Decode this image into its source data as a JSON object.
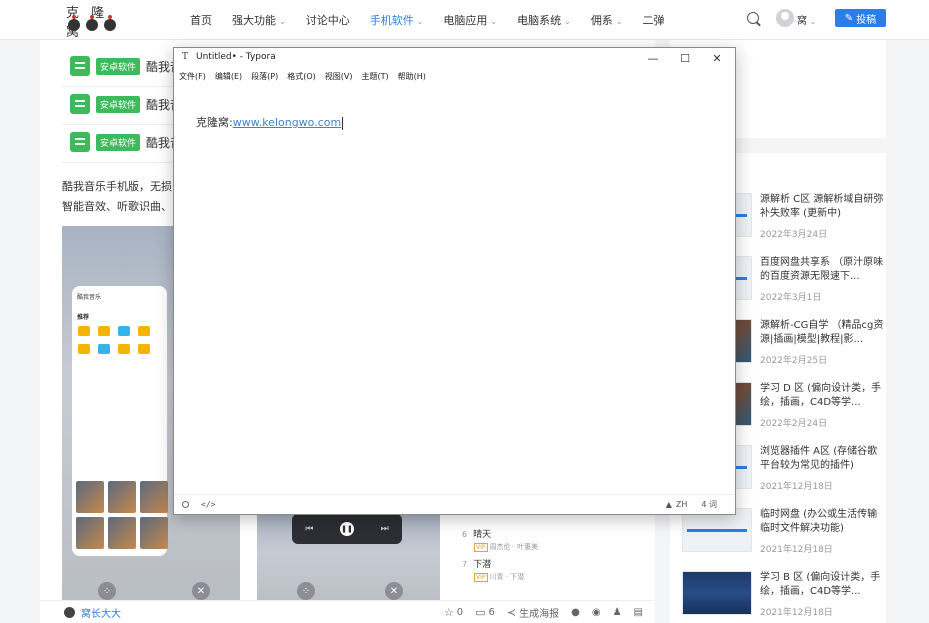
{
  "site": {
    "logo_text": "克 隆 窝",
    "nav": [
      {
        "label": "首页",
        "caret": false,
        "active": false
      },
      {
        "label": "强大功能",
        "caret": true,
        "active": false
      },
      {
        "label": "讨论中心",
        "caret": false,
        "active": false
      },
      {
        "label": "手机软件",
        "caret": true,
        "active": true
      },
      {
        "label": "电脑应用",
        "caret": true,
        "active": false
      },
      {
        "label": "电脑系统",
        "caret": true,
        "active": false
      },
      {
        "label": "佣系",
        "caret": true,
        "active": false
      },
      {
        "label": "二弹",
        "caret": false,
        "active": false
      }
    ],
    "user_name": "窝",
    "post_button": "投稿",
    "accent": "#2b7de9"
  },
  "article": {
    "app_rows": [
      {
        "tag": "安卓软件",
        "title": "酷我音"
      },
      {
        "tag": "安卓软件",
        "title": "酷我音"
      },
      {
        "tag": "安卓软件",
        "title": "酷我音"
      }
    ],
    "intro_line1": "酷我音乐手机版，无损",
    "intro_line2": "智能音效、听歌识曲、",
    "phone_app_name": "酷我音乐",
    "phone_tab": "推荐",
    "songs": [
      {
        "idx": "6",
        "name": "晴天",
        "meta": "周杰伦 · 叶惠美"
      },
      {
        "idx": "7",
        "name": "下潜",
        "meta": "川青 · 下潜"
      }
    ],
    "author": "窝长大大",
    "stars": "0",
    "comments": "6",
    "share_label": "生成海报"
  },
  "sidebar": [
    {
      "title": "源解析 C区 源解析域自研弥补失败率 (更新中)",
      "date": "2022年3月24日",
      "thumb": "light"
    },
    {
      "title": "百度网盘共享系 （原汁原味的百度资源无限速下...",
      "date": "2022年3月1日",
      "thumb": "light"
    },
    {
      "title": "源解析-CG自学 （精品cg资源|插画|模型|教程|影...",
      "date": "2022年2月25日",
      "thumb": "dark"
    },
    {
      "title": "学习 D 区 (偏向设计类，手绘，插画，C4D等学...",
      "date": "2022年2月24日",
      "thumb": "dark"
    },
    {
      "title": "浏览器插件 A区 (存储谷歌平台较为常见的插件)",
      "date": "2021年12月18日",
      "thumb": "light"
    },
    {
      "title": "临时网盘 (办公或生活传输临时文件解决功能)",
      "date": "2021年12月18日",
      "thumb": "light"
    },
    {
      "title": "学习 B 区 (偏向设计类，手绘，插画，C4D等学...",
      "date": "2021年12月18日",
      "thumb": "blue"
    }
  ],
  "typora": {
    "glyph": "T",
    "title": "Untitled• - Typora",
    "controls": [
      "—",
      "☐",
      "✕"
    ],
    "menus": [
      "文件(F)",
      "编辑(E)",
      "段落(P)",
      "格式(O)",
      "视图(V)",
      "主题(T)",
      "帮助(H)"
    ],
    "line_prefix": "克隆窝:",
    "line_link": "www.kelongwo.com",
    "status_code": "</>",
    "status_warn": "▲",
    "status_lang": "ZH",
    "status_words": "4 词"
  }
}
